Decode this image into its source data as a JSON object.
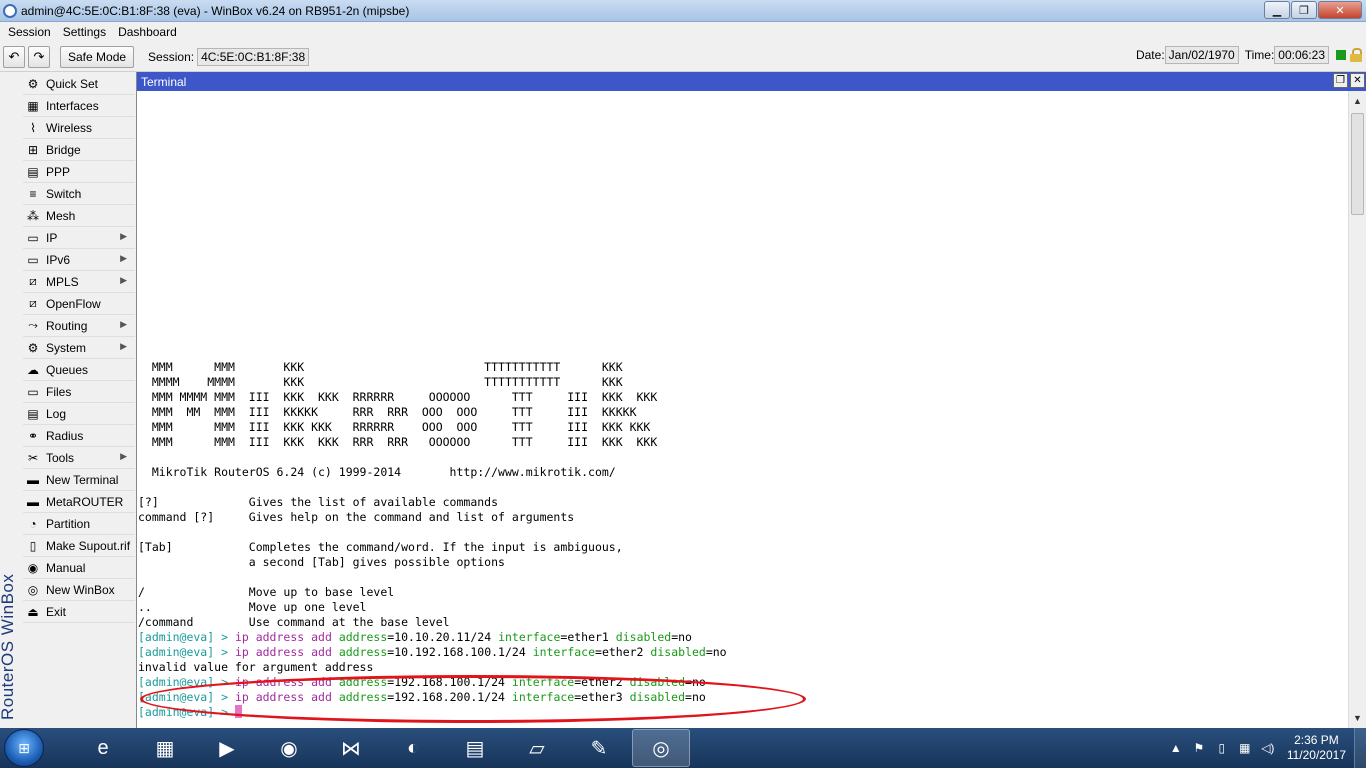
{
  "window": {
    "title": "admin@4C:5E:0C:B1:8F:38 (eva) - WinBox v6.24 on RB951-2n (mipsbe)"
  },
  "menu": [
    "Session",
    "Settings",
    "Dashboard"
  ],
  "toolbar": {
    "undo_icon": "undo-icon",
    "redo_icon": "redo-icon",
    "safe_mode": "Safe Mode",
    "session_label": "Session:",
    "session_value": "4C:5E:0C:B1:8F:38",
    "date_label": "Date:",
    "date_value": "Jan/02/1970",
    "time_label": "Time:",
    "time_value": "00:06:23"
  },
  "brand": "RouterOS WinBox",
  "sidebar": [
    {
      "label": "Quick Set",
      "icon": "quick-set-icon",
      "submenu": false
    },
    {
      "label": "Interfaces",
      "icon": "interfaces-icon",
      "submenu": false
    },
    {
      "label": "Wireless",
      "icon": "wireless-icon",
      "submenu": false
    },
    {
      "label": "Bridge",
      "icon": "bridge-icon",
      "submenu": false
    },
    {
      "label": "PPP",
      "icon": "ppp-icon",
      "submenu": false
    },
    {
      "label": "Switch",
      "icon": "switch-icon",
      "submenu": false
    },
    {
      "label": "Mesh",
      "icon": "mesh-icon",
      "submenu": false
    },
    {
      "label": "IP",
      "icon": "ip-icon",
      "submenu": true
    },
    {
      "label": "IPv6",
      "icon": "ipv6-icon",
      "submenu": true
    },
    {
      "label": "MPLS",
      "icon": "mpls-icon",
      "submenu": true
    },
    {
      "label": "OpenFlow",
      "icon": "openflow-icon",
      "submenu": false
    },
    {
      "label": "Routing",
      "icon": "routing-icon",
      "submenu": true
    },
    {
      "label": "System",
      "icon": "system-icon",
      "submenu": true
    },
    {
      "label": "Queues",
      "icon": "queues-icon",
      "submenu": false
    },
    {
      "label": "Files",
      "icon": "files-icon",
      "submenu": false
    },
    {
      "label": "Log",
      "icon": "log-icon",
      "submenu": false
    },
    {
      "label": "Radius",
      "icon": "radius-icon",
      "submenu": false
    },
    {
      "label": "Tools",
      "icon": "tools-icon",
      "submenu": true
    },
    {
      "label": "New Terminal",
      "icon": "terminal-icon",
      "submenu": false
    },
    {
      "label": "MetaROUTER",
      "icon": "metarouter-icon",
      "submenu": false
    },
    {
      "label": "Partition",
      "icon": "partition-icon",
      "submenu": false
    },
    {
      "label": "Make Supout.rif",
      "icon": "supout-icon",
      "submenu": false
    },
    {
      "label": "Manual",
      "icon": "manual-icon",
      "submenu": false
    },
    {
      "label": "New WinBox",
      "icon": "winbox-icon",
      "submenu": false
    },
    {
      "label": "Exit",
      "icon": "exit-icon",
      "submenu": false
    }
  ],
  "terminal": {
    "title": "Terminal",
    "banner": [
      "  MMM      MMM       KKK                          TTTTTTTTTTT      KKK",
      "  MMMM    MMMM       KKK                          TTTTTTTTTTT      KKK",
      "  MMM MMMM MMM  III  KKK  KKK  RRRRRR     OOOOOO      TTT     III  KKK  KKK",
      "  MMM  MM  MMM  III  KKKKK     RRR  RRR  OOO  OOO     TTT     III  KKKKK",
      "  MMM      MMM  III  KKK KKK   RRRRRR    OOO  OOO     TTT     III  KKK KKK",
      "  MMM      MMM  III  KKK  KKK  RRR  RRR   OOOOOO      TTT     III  KKK  KKK",
      "",
      "  MikroTik RouterOS 6.24 (c) 1999-2014       http://www.mikrotik.com/",
      "",
      "[?]             Gives the list of available commands",
      "command [?]     Gives help on the command and list of arguments",
      "",
      "[Tab]           Completes the command/word. If the input is ambiguous,",
      "                a second [Tab] gives possible options",
      "",
      "/               Move up to base level",
      "..              Move up one level",
      "/command        Use command at the base level"
    ],
    "commands": [
      {
        "prompt": "[admin@eva] > ",
        "cmd": "ip address add",
        "k1": "address",
        "v1": "=10.10.20.11/24",
        "k2": "interface",
        "v2": "=ether1",
        "k3": "disabled",
        "v3": "=no"
      },
      {
        "prompt": "[admin@eva] > ",
        "cmd": "ip address add",
        "k1": "address",
        "v1": "=10.192.168.100.1/24",
        "k2": "interface",
        "v2": "=ether2",
        "k3": "disabled",
        "v3": "=no"
      }
    ],
    "error": "invalid value for argument address",
    "commands2": [
      {
        "prompt": "[admin@eva] > ",
        "cmd": "ip address add",
        "k1": "address",
        "v1": "=192.168.100.1/24",
        "k2": "interface",
        "v2": "=ether2",
        "k3": "disabled",
        "v3": "=no"
      },
      {
        "prompt": "[admin@eva] > ",
        "cmd": "ip address add",
        "k1": "address",
        "v1": "=192.168.200.1/24",
        "k2": "interface",
        "v2": "=ether3",
        "k3": "disabled",
        "v3": "=no"
      }
    ],
    "final_prompt": "[admin@eva] > ",
    "annotation_color": "#e0141a"
  },
  "taskbar": {
    "apps": [
      {
        "name": "ie-icon",
        "glyph": "e",
        "active": false
      },
      {
        "name": "explorer-icon",
        "glyph": "▦",
        "active": false
      },
      {
        "name": "media-player-icon",
        "glyph": "▶",
        "active": false
      },
      {
        "name": "chrome-icon",
        "glyph": "◉",
        "active": false
      },
      {
        "name": "visual-studio-icon",
        "glyph": "⋈",
        "active": false
      },
      {
        "name": "firefox-icon",
        "glyph": "◐",
        "active": false
      },
      {
        "name": "network-icon",
        "glyph": "▤",
        "active": false
      },
      {
        "name": "notes-icon",
        "glyph": "▱",
        "active": false
      },
      {
        "name": "paint-icon",
        "glyph": "✎",
        "active": false
      },
      {
        "name": "winbox-taskbar-icon",
        "glyph": "◎",
        "active": true
      }
    ],
    "clock_time": "2:36 PM",
    "clock_date": "11/20/2017"
  }
}
